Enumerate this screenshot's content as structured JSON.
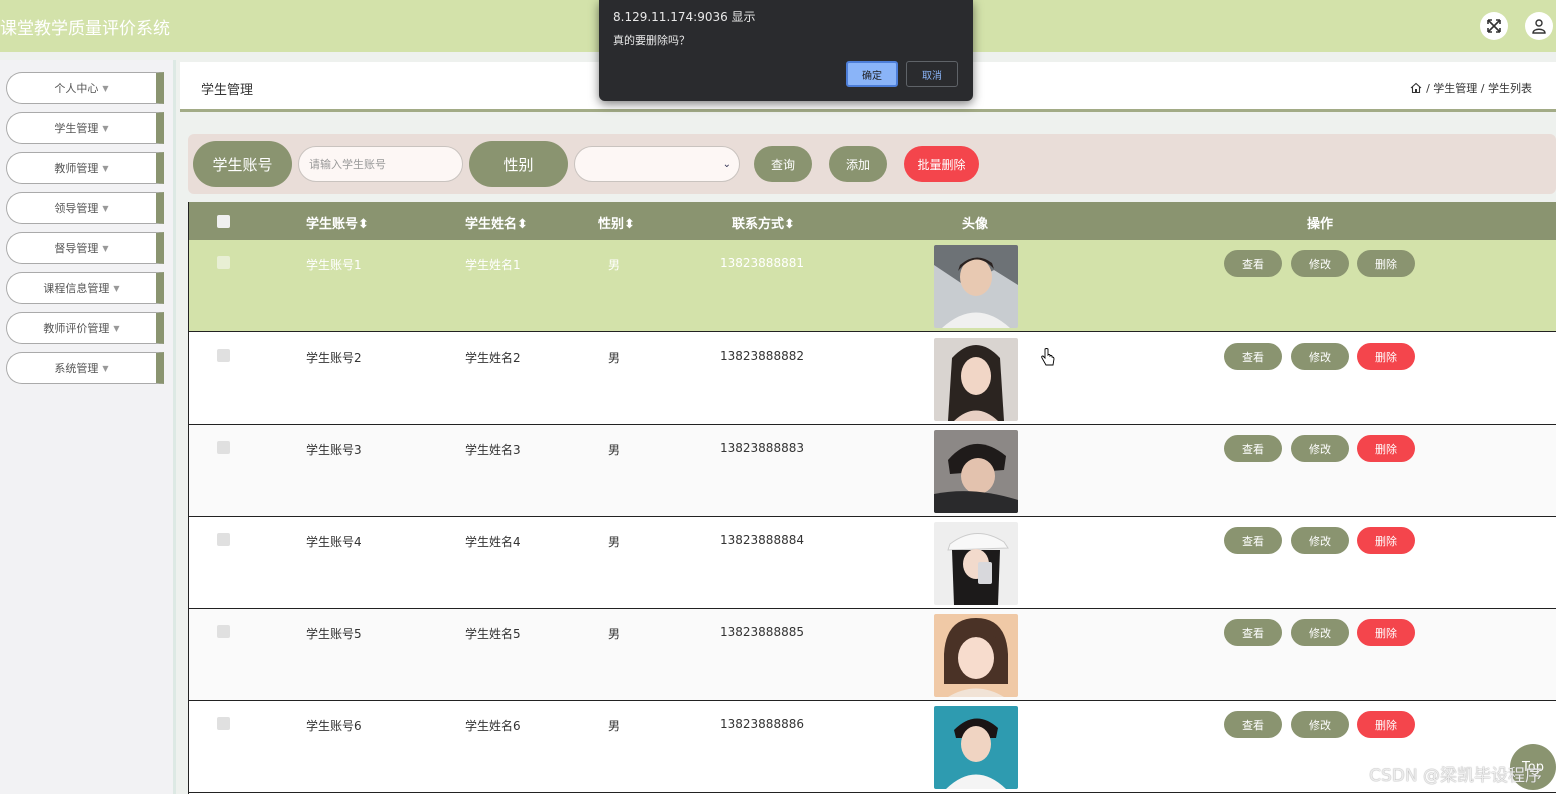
{
  "header": {
    "app_title": "课堂教学质量评价系统"
  },
  "sidebar": {
    "items": [
      {
        "label": "个人中心"
      },
      {
        "label": "学生管理"
      },
      {
        "label": "教师管理"
      },
      {
        "label": "领导管理"
      },
      {
        "label": "督导管理"
      },
      {
        "label": "课程信息管理"
      },
      {
        "label": "教师评价管理"
      },
      {
        "label": "系统管理"
      }
    ]
  },
  "breadcrumb": {
    "title": "学生管理",
    "path": "/ 学生管理 / 学生列表"
  },
  "search": {
    "account_label": "学生账号",
    "account_placeholder": "请输入学生账号",
    "gender_label": "性别",
    "gender_value": "",
    "query_button": "查询",
    "add_button": "添加",
    "batch_delete_button": "批量删除"
  },
  "table": {
    "columns": [
      "学生账号",
      "学生姓名",
      "性别",
      "联系方式",
      "头像",
      "操作"
    ],
    "sort_glyph": "⬍",
    "actions": {
      "view": "查看",
      "edit": "修改",
      "delete": "删除"
    },
    "rows": [
      {
        "account": "学生账号1",
        "name": "学生姓名1",
        "gender": "男",
        "phone": "13823888881"
      },
      {
        "account": "学生账号2",
        "name": "学生姓名2",
        "gender": "男",
        "phone": "13823888882"
      },
      {
        "account": "学生账号3",
        "name": "学生姓名3",
        "gender": "男",
        "phone": "13823888883"
      },
      {
        "account": "学生账号4",
        "name": "学生姓名4",
        "gender": "男",
        "phone": "13823888884"
      },
      {
        "account": "学生账号5",
        "name": "学生姓名5",
        "gender": "男",
        "phone": "13823888885"
      },
      {
        "account": "学生账号6",
        "name": "学生姓名6",
        "gender": "男",
        "phone": "13823888886"
      }
    ]
  },
  "dialog": {
    "title": "8.129.11.174:9036 显示",
    "message": "真的要删除吗？",
    "ok": "确定",
    "cancel": "取消"
  },
  "watermark": "CSDN @梁凯毕设程序",
  "top_button": "Top",
  "colors": {
    "accent": "#8a9470",
    "header_bg": "#d3e2aa",
    "danger": "#f4454c"
  }
}
